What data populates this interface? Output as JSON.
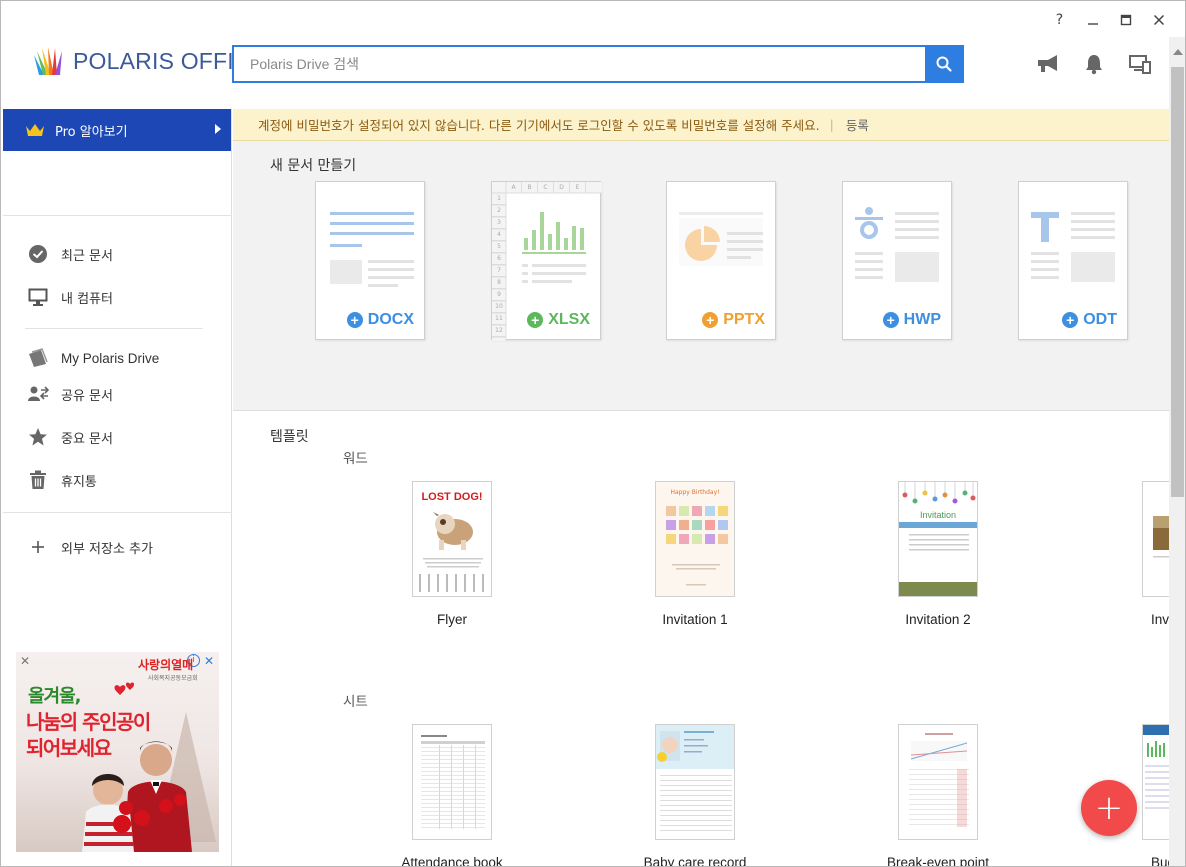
{
  "window": {
    "help": "?",
    "minimize": "—",
    "maximize": "☐",
    "close": "✕"
  },
  "header": {
    "logo_text": "POLARIS OFFICE",
    "search_placeholder": "Polaris Drive 검색",
    "icons": [
      "megaphone-icon",
      "bell-icon",
      "devices-icon"
    ]
  },
  "sidebar": {
    "pro_label": "Pro 알아보기",
    "items": [
      {
        "label": "최근 문서",
        "icon": "clock-check-icon"
      },
      {
        "label": "내 컴퓨터",
        "icon": "monitor-icon"
      },
      {
        "label": "My Polaris Drive",
        "icon": "drive-icon"
      },
      {
        "label": "공유 문서",
        "icon": "share-users-icon"
      },
      {
        "label": "중요 문서",
        "icon": "star-icon"
      },
      {
        "label": "휴지통",
        "icon": "trash-icon"
      },
      {
        "label": "외부 저장소 추가",
        "icon": "plus-icon"
      }
    ],
    "ad": {
      "brand": "사랑의열매",
      "sub": "사회복지공동모금회",
      "line1": "올겨울,",
      "line2": "나눔의 주인공이",
      "line3": "되어보세요"
    }
  },
  "notice": {
    "text": "계정에 비밀번호가 설정되어 있지 않습니다. 다른 기기에서도 로그인할 수 있도록 비밀번호를 설정해 주세요.",
    "separator": "|",
    "link": "등록"
  },
  "new_document": {
    "title": "새 문서 만들기",
    "types": [
      {
        "label": "DOCX",
        "color": "#3d8fe0"
      },
      {
        "label": "XLSX",
        "color": "#5cb85c"
      },
      {
        "label": "PPTX",
        "color": "#f0a030"
      },
      {
        "label": "HWP",
        "color": "#3d8fe0"
      },
      {
        "label": "ODT",
        "color": "#3d8fe0"
      }
    ],
    "xlsx_cols": [
      "A",
      "B",
      "C",
      "D",
      "E"
    ],
    "xlsx_rows": [
      "1",
      "2",
      "3",
      "4",
      "5",
      "6",
      "7",
      "8",
      "9",
      "10",
      "11",
      "12"
    ]
  },
  "templates": {
    "title": "템플릿",
    "word_label": "워드",
    "sheet_label": "시트",
    "word": [
      {
        "name": "Flyer",
        "thumb_title": "LOST DOG!"
      },
      {
        "name": "Invitation 1",
        "thumb_title": "Happy Birthday!"
      },
      {
        "name": "Invitation 2",
        "thumb_title": "Invitation"
      },
      {
        "name": "Invi"
      }
    ],
    "sheet": [
      {
        "name": "Attendance book"
      },
      {
        "name": "Baby care record"
      },
      {
        "name": "Break-even point"
      },
      {
        "name": "Budge"
      }
    ]
  },
  "fab_label": "+"
}
